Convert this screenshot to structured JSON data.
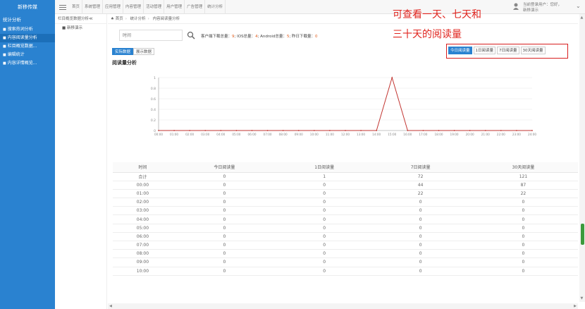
{
  "brand": "新移传媒",
  "nav": [
    "首页",
    "系统管理",
    "应用管理",
    "内容管理",
    "活动管理",
    "用户管理",
    "广告管理",
    "统计分析"
  ],
  "user": {
    "line1": "当前登录用户：您好，",
    "line2": "新移演示"
  },
  "sidebar": {
    "title": "统计分析",
    "items": [
      {
        "label": "搜索热词分析",
        "active": false
      },
      {
        "label": "内容阅读量分析",
        "active": true
      },
      {
        "label": "栏目概览数据...",
        "active": false
      },
      {
        "label": "编辑统计",
        "active": false
      },
      {
        "label": "内容详情概览...",
        "active": false
      }
    ]
  },
  "tree": {
    "title": "栏目概览数据分析≪",
    "item": "新移演示"
  },
  "breadcrumb": [
    "首页",
    "统计分析",
    "内容阅读量分析"
  ],
  "search": {
    "placeholder": "时间"
  },
  "stats": {
    "p1": "客户端下载总量：",
    "v1": "9",
    "p2": "; IOS总量：",
    "v2": "4",
    "p3": "; Android总量：",
    "v3": "5",
    "p4": "; 昨日下载量：",
    "v4": "0"
  },
  "mode_tabs": [
    {
      "label": "实际数据",
      "active": true
    },
    {
      "label": "展示数据",
      "active": false
    }
  ],
  "section_title": "阅读量分析",
  "annotation": {
    "line1": "可查看一天、七天和",
    "line2": "三十天的阅读量"
  },
  "range_tabs": [
    {
      "label": "今日阅读量",
      "active": true
    },
    {
      "label": "1日阅读量",
      "active": false
    },
    {
      "label": "7日阅读量",
      "active": false
    },
    {
      "label": "30天阅读量",
      "active": false
    }
  ],
  "chart_data": {
    "type": "line",
    "x": [
      "00:00",
      "01:00",
      "02:00",
      "03:00",
      "04:00",
      "05:00",
      "06:00",
      "07:00",
      "08:00",
      "09:00",
      "10:00",
      "11:00",
      "12:00",
      "13:00",
      "14:00",
      "15:00",
      "16:00",
      "17:00",
      "18:00",
      "19:00",
      "20:00",
      "21:00",
      "22:00",
      "23:00",
      "24:00"
    ],
    "series": [
      {
        "values": [
          0,
          0,
          0,
          0,
          0,
          0,
          0,
          0,
          0,
          0,
          0,
          0,
          0,
          0,
          0,
          1,
          0,
          0,
          0,
          0,
          0,
          0,
          0,
          0,
          0
        ],
        "color": "#c23531"
      }
    ],
    "y_ticks": [
      "0",
      "0.2",
      "0.4",
      "0.6",
      "0.8",
      "1"
    ],
    "ylim": [
      0,
      1
    ],
    "grid": true
  },
  "table": {
    "headers": [
      "时间",
      "今日阅读量",
      "1日阅读量",
      "7日阅读量",
      "30天阅读量"
    ],
    "rows": [
      [
        "合计",
        "0",
        "1",
        "72",
        "121"
      ],
      [
        "00:00",
        "0",
        "0",
        "44",
        "87"
      ],
      [
        "01:00",
        "0",
        "0",
        "22",
        "22"
      ],
      [
        "02:00",
        "0",
        "0",
        "0",
        "0"
      ],
      [
        "03:00",
        "0",
        "0",
        "0",
        "0"
      ],
      [
        "04:00",
        "0",
        "0",
        "0",
        "0"
      ],
      [
        "05:00",
        "0",
        "0",
        "0",
        "0"
      ],
      [
        "06:00",
        "0",
        "0",
        "0",
        "0"
      ],
      [
        "07:00",
        "0",
        "0",
        "0",
        "0"
      ],
      [
        "08:00",
        "0",
        "0",
        "0",
        "0"
      ],
      [
        "09:00",
        "0",
        "0",
        "0",
        "0"
      ],
      [
        "10:00",
        "0",
        "0",
        "0",
        "0"
      ]
    ]
  }
}
